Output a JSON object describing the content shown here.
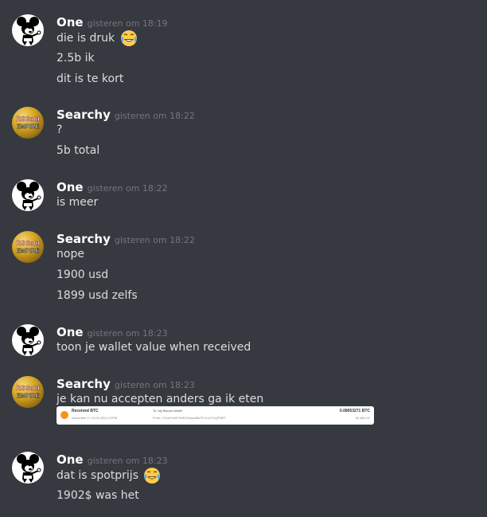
{
  "messages": [
    {
      "author": "One",
      "time": "gisteren om 18:19",
      "lines": [
        "die is druk",
        "2.5b ik",
        "dit is te kort"
      ],
      "emoji_after_first_line": "joy-emoji"
    },
    {
      "author": "Searchy",
      "time": "gisteren om 18:22",
      "lines": [
        "?",
        "5b total"
      ]
    },
    {
      "author": "One",
      "time": "gisteren om 18:22",
      "lines": [
        "is meer"
      ]
    },
    {
      "author": "Searchy",
      "time": "gisteren om 18:22",
      "lines": [
        "nope",
        "1900 usd",
        "1899 usd zelfs"
      ]
    },
    {
      "author": "One",
      "time": "gisteren om 18:23",
      "lines": [
        "toon je wallet value when received"
      ]
    },
    {
      "author": "Searchy",
      "time": "gisteren om 18:23",
      "lines": [
        "je kan nu accepten anders ga ik eten"
      ]
    },
    {
      "author": "One",
      "time": "gisteren om 18:23",
      "lines": [
        "dat is spotprijs",
        "1902$ was het"
      ],
      "emoji_after_first_line": "joy-emoji"
    }
  ],
  "avatars": {
    "one": {
      "icon": "mickey-mouse-avatar"
    },
    "searchy": {
      "icon": "rsgold-empire-avatar",
      "line1": "RSGold",
      "line2": "EMPIRE"
    }
  },
  "attachment": {
    "title": "Received BTC",
    "date": "December 17 23:20 (BX) COPM",
    "to": "To: My Bitcoin Wallet",
    "from": "From: 17wuFnNf7YeRGGwyhsBeFFJLc2YOQFBFF",
    "amount": "0.08053271 BTC",
    "usd": "$1,899.21"
  },
  "colors": {
    "background": "#36393f",
    "author": "#ffffff",
    "timestamp": "#72767d",
    "text": "#dcddde"
  }
}
